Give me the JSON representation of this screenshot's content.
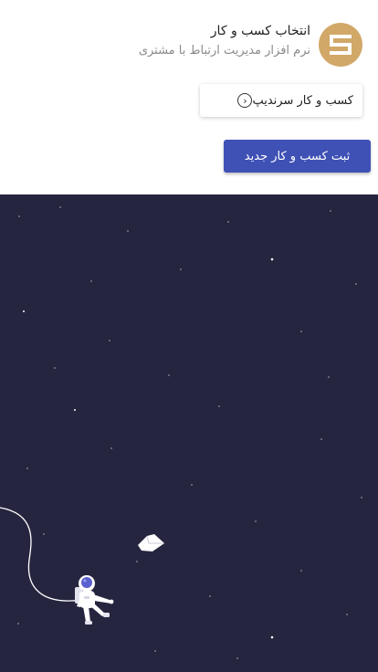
{
  "header": {
    "title": "انتخاب کسب و کار",
    "subtitle": "نرم افزار مدیریت ارتباط با مشتری",
    "logo_color": "#d1a868"
  },
  "business_list": [
    {
      "label": "کسب و کار سرندیپ",
      "icon": "chevron-left-circle-icon"
    }
  ],
  "actions": {
    "new_business_label": "ثبت کسب و کار جدید",
    "button_color": "#3f51b5"
  },
  "illustration": {
    "background": "#26253f",
    "elements": [
      "stars",
      "astronaut",
      "tether",
      "paper-plane"
    ]
  }
}
